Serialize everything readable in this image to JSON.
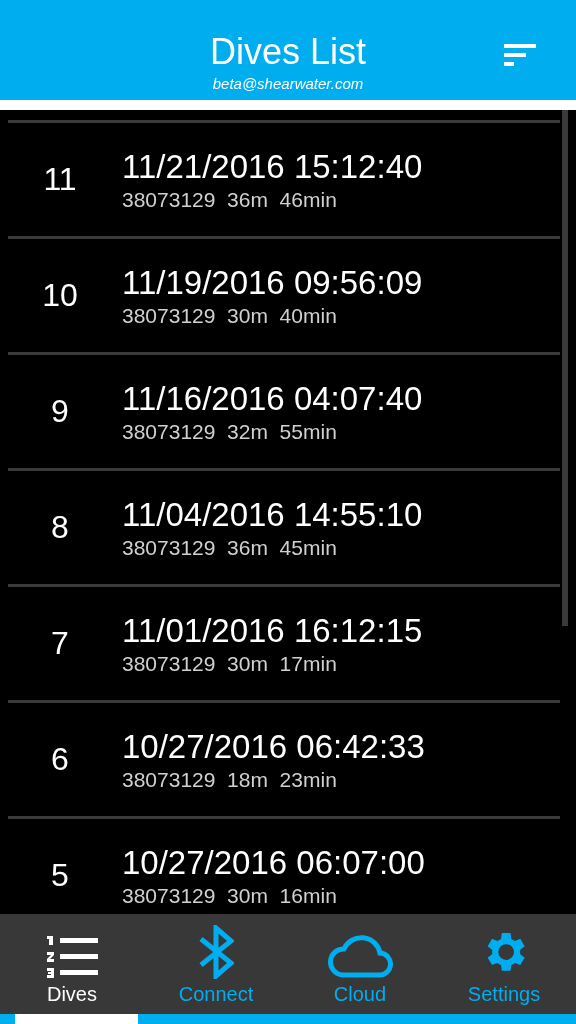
{
  "header": {
    "title": "Dives List",
    "subtitle": "beta@shearwater.com"
  },
  "dives": [
    {
      "number": "11",
      "datetime": "11/21/2016 15:12:40",
      "details": "38073129  36m  46min"
    },
    {
      "number": "10",
      "datetime": "11/19/2016 09:56:09",
      "details": "38073129  30m  40min"
    },
    {
      "number": "9",
      "datetime": "11/16/2016 04:07:40",
      "details": "38073129  32m  55min"
    },
    {
      "number": "8",
      "datetime": "11/04/2016 14:55:10",
      "details": "38073129  36m  45min"
    },
    {
      "number": "7",
      "datetime": "11/01/2016 16:12:15",
      "details": "38073129  30m  17min"
    },
    {
      "number": "6",
      "datetime": "10/27/2016 06:42:33",
      "details": "38073129  18m  23min"
    },
    {
      "number": "5",
      "datetime": "10/27/2016 06:07:00",
      "details": "38073129  30m  16min"
    }
  ],
  "tabs": [
    {
      "kind": "dives",
      "label": "Dives",
      "selected": true
    },
    {
      "kind": "connect",
      "label": "Connect",
      "selected": false
    },
    {
      "kind": "cloud",
      "label": "Cloud",
      "selected": false
    },
    {
      "kind": "settings",
      "label": "Settings",
      "selected": false
    }
  ]
}
